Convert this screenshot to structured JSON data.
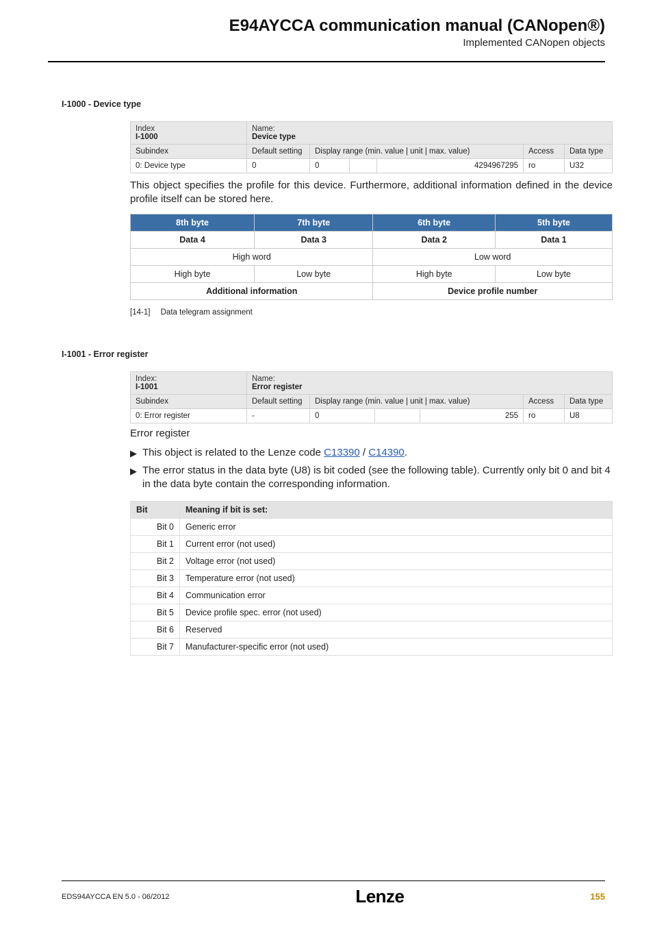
{
  "header": {
    "title": "E94AYCCA communication manual (CANopen®)",
    "subtitle": "Implemented CANopen objects"
  },
  "sec1": {
    "title": "I-1000 - Device type",
    "index_label": "Index",
    "index_value": "I-1000",
    "name_label": "Name:",
    "name_value": "Device type",
    "cols": {
      "sub": "Subindex",
      "def": "Default setting",
      "range": "Display range (min. value | unit | max. value)",
      "acc": "Access",
      "dtype": "Data type"
    },
    "row": {
      "sub": "0: Device type",
      "def": "0",
      "min": "0",
      "unit": "",
      "max": "4294967295",
      "acc": "ro",
      "dtype": "U32"
    },
    "para": "This object specifies the profile for this device. Furthermore, additional information defined in the device profile itself can be stored here.",
    "bytehdr": {
      "b8": "8th byte",
      "b7": "7th byte",
      "b6": "6th byte",
      "b5": "5th byte"
    },
    "datarow": {
      "d4": "Data 4",
      "d3": "Data 3",
      "d2": "Data 2",
      "d1": "Data 1"
    },
    "words": {
      "hw": "High word",
      "lw": "Low word"
    },
    "bytes": {
      "hb": "High byte",
      "lb": "Low byte"
    },
    "foot": {
      "ai": "Additional information",
      "dpn": "Device profile number"
    },
    "caption_tag": "[14-1]",
    "caption_text": "Data telegram assignment"
  },
  "sec2": {
    "title": "I-1001 - Error register",
    "index_label": "Index:",
    "index_value": "I-1001",
    "name_label": "Name:",
    "name_value": "Error register",
    "cols": {
      "sub": "Subindex",
      "def": "Default setting",
      "range": "Display range (min. value | unit | max. value)",
      "acc": "Access",
      "dtype": "Data type"
    },
    "row": {
      "sub": "0: Error register",
      "def": "-",
      "min": "0",
      "unit": "",
      "max": "255",
      "acc": "ro",
      "dtype": "U8"
    },
    "intro": "Error register",
    "b1_a": "This object is related to the Lenze code ",
    "link1": "C13390",
    "b1_b": "  / ",
    "link2": "C14390",
    "b1_c": ".",
    "b2": "The error status in the data byte (U8) is bit coded (see the following table). Currently only bit 0 and bit 4 in the data byte contain the corresponding information.",
    "bit_hdr": {
      "bit": "Bit",
      "meaning": "Meaning if bit is set:"
    },
    "bits": [
      {
        "b": "Bit 0",
        "m": "Generic error"
      },
      {
        "b": "Bit 1",
        "m": "Current error (not used)"
      },
      {
        "b": "Bit 2",
        "m": "Voltage error (not used)"
      },
      {
        "b": "Bit 3",
        "m": "Temperature error (not used)"
      },
      {
        "b": "Bit 4",
        "m": "Communication error"
      },
      {
        "b": "Bit 5",
        "m": "Device profile spec. error (not used)"
      },
      {
        "b": "Bit 6",
        "m": "Reserved"
      },
      {
        "b": "Bit 7",
        "m": "Manufacturer-specific error (not used)"
      }
    ]
  },
  "footer": {
    "doc": "EDS94AYCCA EN 5.0 - 06/2012",
    "logo": "Lenze",
    "page": "155"
  }
}
